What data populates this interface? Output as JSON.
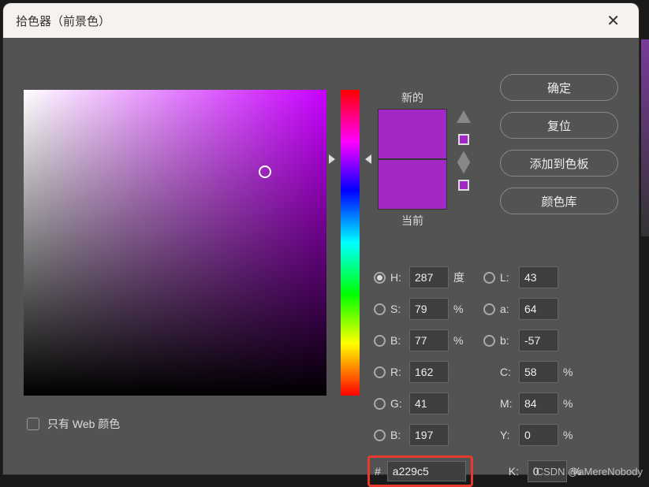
{
  "title": "拾色器（前景色）",
  "swatch": {
    "new_label": "新的",
    "current_label": "当前"
  },
  "buttons": {
    "ok": "确定",
    "reset": "复位",
    "add": "添加到色板",
    "library": "颜色库"
  },
  "web_only": "只有 Web 颜色",
  "hsb": {
    "h_label": "H:",
    "h_value": "287",
    "h_unit": "度",
    "s_label": "S:",
    "s_value": "79",
    "s_unit": "%",
    "b_label": "B:",
    "b_value": "77",
    "b_unit": "%"
  },
  "lab": {
    "l_label": "L:",
    "l_value": "43",
    "a_label": "a:",
    "a_value": "64",
    "b_label": "b:",
    "b_value": "-57"
  },
  "rgb": {
    "r_label": "R:",
    "r_value": "162",
    "g_label": "G:",
    "g_value": "41",
    "b_label": "B:",
    "b_value": "197"
  },
  "cmyk": {
    "c_label": "C:",
    "c_value": "58",
    "c_unit": "%",
    "m_label": "M:",
    "m_value": "84",
    "m_unit": "%",
    "y_label": "Y:",
    "y_value": "0",
    "y_unit": "%",
    "k_label": "K:",
    "k_value": "0",
    "k_unit": "%"
  },
  "hex": {
    "label": "#",
    "value": "a229c5"
  },
  "watermark": "CSDN @aMereNobody"
}
